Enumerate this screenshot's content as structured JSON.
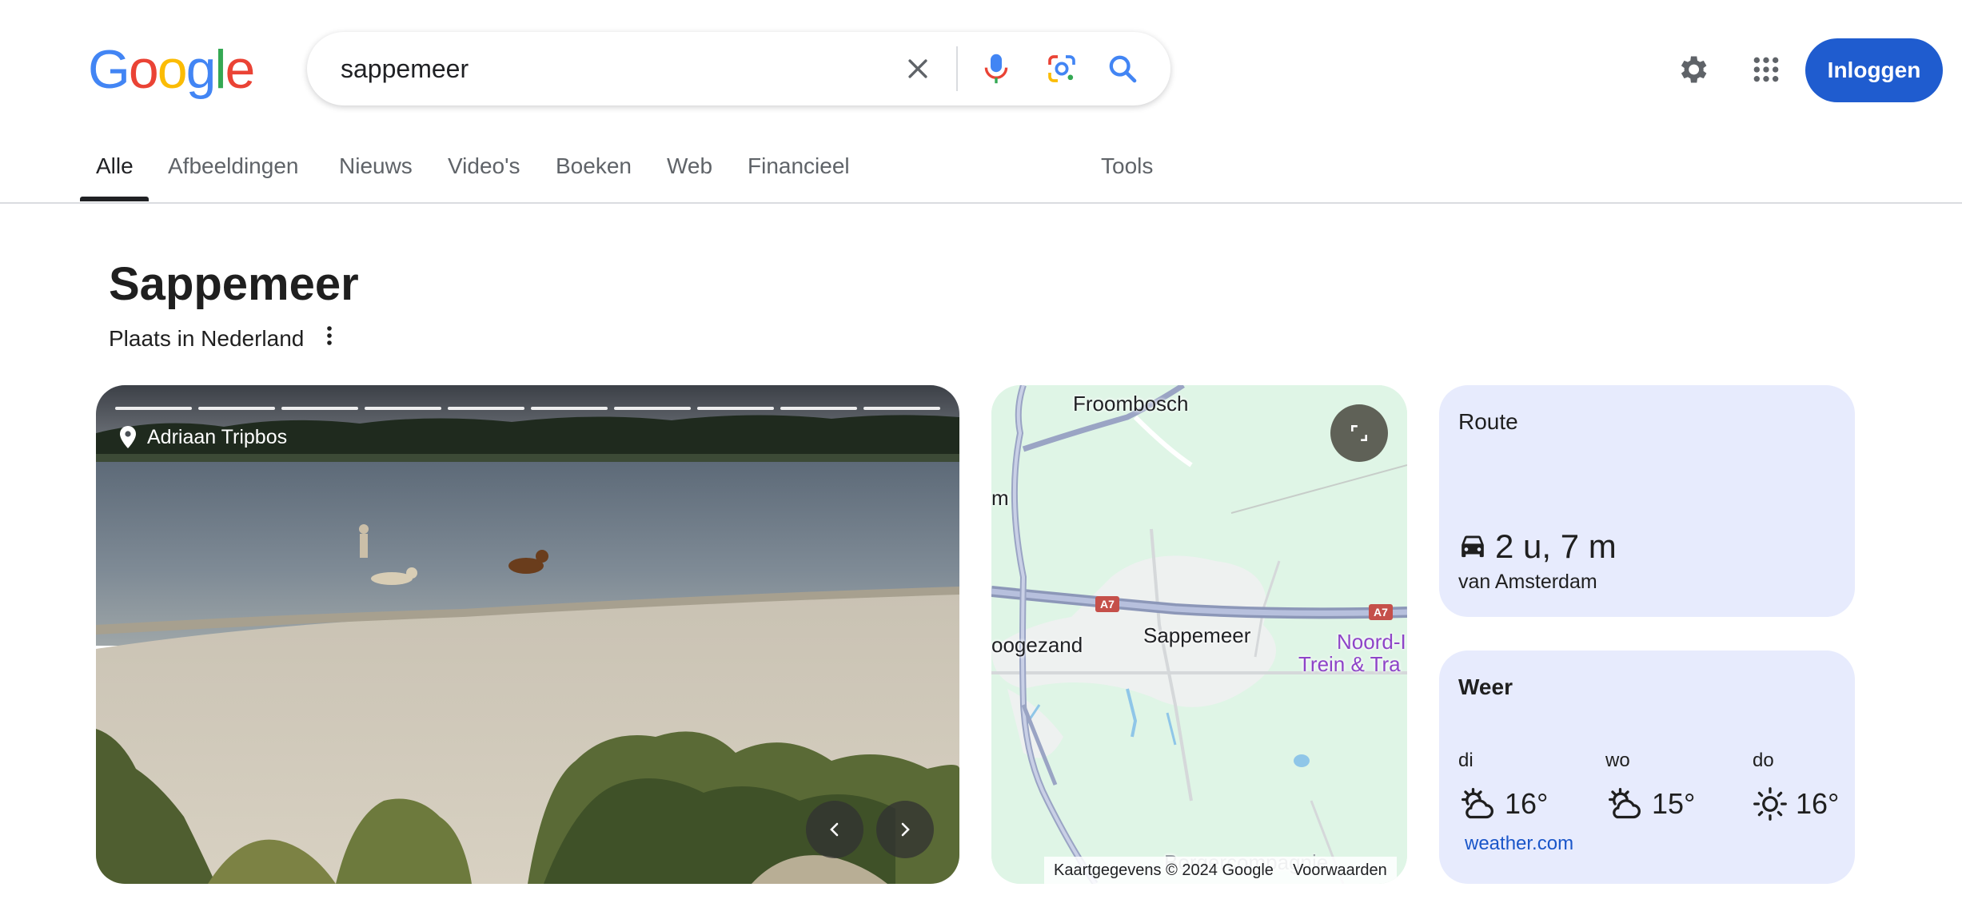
{
  "header": {
    "logo_text": "Google",
    "search_value": "sappemeer",
    "login_label": "Inloggen",
    "icons": [
      "clear-icon",
      "mic-icon",
      "lens-icon",
      "search-icon",
      "settings-icon",
      "apps-icon"
    ]
  },
  "tabs": {
    "items": [
      {
        "label": "Alle",
        "active": true
      },
      {
        "label": "Afbeeldingen"
      },
      {
        "label": "Nieuws"
      },
      {
        "label": "Video's"
      },
      {
        "label": "Boeken"
      },
      {
        "label": "Web"
      },
      {
        "label": "Financieel"
      }
    ],
    "tools_label": "Tools"
  },
  "entity": {
    "title": "Sappemeer",
    "subtitle": "Plaats in Nederland"
  },
  "photo": {
    "location": "Adriaan Tripbos",
    "slide_count": 10
  },
  "map": {
    "labels": {
      "froombosch": "Froombosch",
      "m": "m",
      "hoogezand": "oogezand",
      "sappemeer": "Sappemeer",
      "noord": "Noord-I",
      "trein": "Trein & Tra",
      "bottom": "Borgercompagnie"
    },
    "road_shield": "A7",
    "footer_data": "Kaartgegevens © 2024 Google",
    "footer_terms": "Voorwaarden"
  },
  "route": {
    "title": "Route",
    "duration": "2 u, 7 m",
    "from": "van Amsterdam"
  },
  "weather": {
    "title": "Weer",
    "days": [
      {
        "name": "di",
        "temp": "16°",
        "icon": "partly-cloudy-icon"
      },
      {
        "name": "wo",
        "temp": "15°",
        "icon": "partly-cloudy-icon"
      },
      {
        "name": "do",
        "temp": "16°",
        "icon": "sunny-icon"
      }
    ],
    "source": "weather.com"
  },
  "colors": {
    "accent": "#1f5ccf",
    "card_bg": "#e7ebfd",
    "map_bg": "#dff5e6"
  }
}
